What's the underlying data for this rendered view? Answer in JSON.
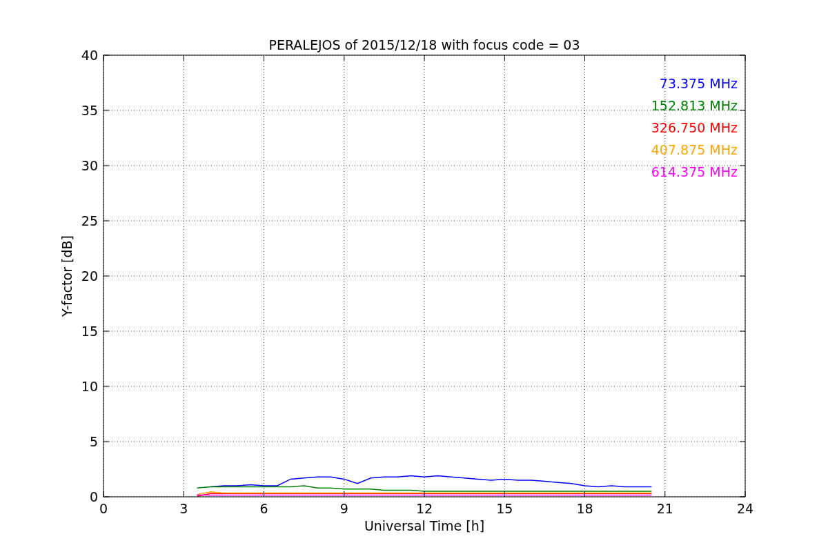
{
  "chart_data": {
    "type": "line",
    "title": "PERALEJOS of 2015/12/18 with focus code = 03",
    "xlabel": "Universal Time [h]",
    "ylabel": "Y-factor [dB]",
    "x": [
      3.5,
      4,
      4.5,
      5,
      5.5,
      6,
      6.5,
      7,
      7.5,
      8,
      8.5,
      9,
      9.5,
      10,
      10.5,
      11,
      11.5,
      12,
      12.5,
      13,
      13.5,
      14,
      14.5,
      15,
      15.5,
      16,
      16.5,
      17,
      17.5,
      18,
      18.5,
      19,
      19.5,
      20,
      20.5
    ],
    "series": [
      {
        "name": "73.375 MHz",
        "color": "#0000ff",
        "values": [
          null,
          0.9,
          1.0,
          1.0,
          1.1,
          1.0,
          1.0,
          1.6,
          1.7,
          1.8,
          1.8,
          1.6,
          1.2,
          1.7,
          1.8,
          1.8,
          1.9,
          1.8,
          1.9,
          1.8,
          1.7,
          1.6,
          1.5,
          1.6,
          1.5,
          1.5,
          1.4,
          1.3,
          1.2,
          1.0,
          0.9,
          1.0,
          0.9,
          0.9,
          0.9
        ]
      },
      {
        "name": "152.813 MHz",
        "color": "#008000",
        "values": [
          0.8,
          0.9,
          0.9,
          0.9,
          0.9,
          0.9,
          0.9,
          0.9,
          1.0,
          0.8,
          0.8,
          0.7,
          0.7,
          0.7,
          0.6,
          0.6,
          0.6,
          0.5,
          0.5,
          0.5,
          0.5,
          0.5,
          0.5,
          0.5,
          0.5,
          0.5,
          0.5,
          0.5,
          0.5,
          0.5,
          0.5,
          0.5,
          0.5,
          0.5,
          0.5
        ]
      },
      {
        "name": "326.750 MHz",
        "color": "#ff0000",
        "values": [
          0.05,
          0.3,
          0.3,
          0.3,
          0.3,
          0.3,
          0.3,
          0.3,
          0.3,
          0.3,
          0.3,
          0.3,
          0.3,
          0.3,
          0.3,
          0.3,
          0.3,
          0.3,
          0.3,
          0.3,
          0.3,
          0.3,
          0.3,
          0.3,
          0.3,
          0.3,
          0.3,
          0.3,
          0.3,
          0.3,
          0.3,
          0.3,
          0.3,
          0.3,
          0.3
        ]
      },
      {
        "name": "407.875 MHz",
        "color": "#ffa500",
        "values": [
          0.2,
          0.45,
          0.35,
          0.35,
          0.35,
          0.35,
          0.35,
          0.35,
          0.35,
          0.35,
          0.35,
          0.35,
          0.35,
          0.35,
          0.35,
          0.35,
          0.35,
          0.35,
          0.35,
          0.35,
          0.35,
          0.35,
          0.35,
          0.35,
          0.35,
          0.35,
          0.35,
          0.35,
          0.35,
          0.35,
          0.35,
          0.35,
          0.35,
          0.35,
          0.35
        ]
      },
      {
        "name": "614.375 MHz",
        "color": "#ff00ff",
        "values": [
          0.15,
          0.15,
          0.15,
          0.15,
          0.15,
          0.15,
          0.15,
          0.15,
          0.15,
          0.15,
          0.15,
          0.15,
          0.15,
          0.15,
          0.15,
          0.15,
          0.15,
          0.15,
          0.15,
          0.15,
          0.15,
          0.15,
          0.15,
          0.15,
          0.15,
          0.15,
          0.15,
          0.15,
          0.15,
          0.15,
          0.15,
          0.15,
          0.15,
          0.15,
          0.15
        ]
      }
    ],
    "grid": true,
    "xlim": [
      0,
      24
    ],
    "ylim": [
      0,
      40
    ],
    "xticks": [
      0,
      3,
      6,
      9,
      12,
      15,
      18,
      21,
      24
    ],
    "yticks": [
      0,
      5,
      10,
      15,
      20,
      25,
      30,
      35,
      40
    ]
  }
}
